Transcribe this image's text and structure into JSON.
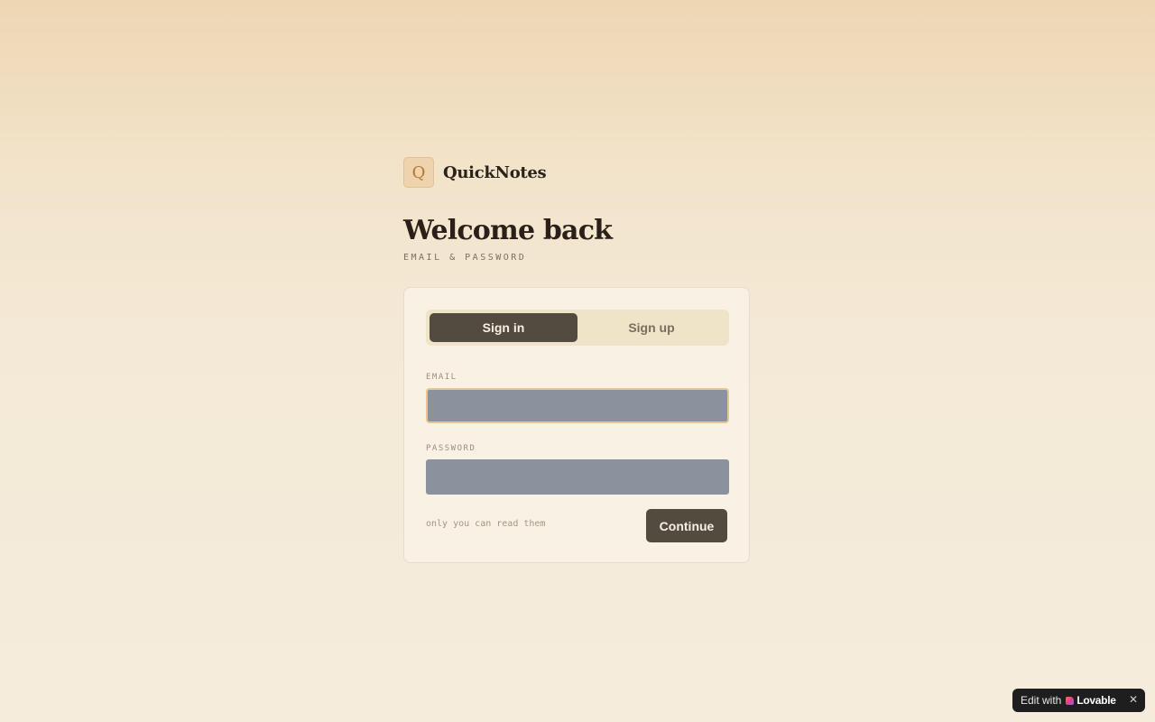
{
  "brand": {
    "logo_letter": "Q",
    "name": "QuickNotes"
  },
  "header": {
    "title": "Welcome back",
    "subtitle": "EMAIL & PASSWORD"
  },
  "auth": {
    "tabs": [
      {
        "label": "Sign in",
        "active": true
      },
      {
        "label": "Sign up",
        "active": false
      }
    ],
    "email": {
      "label": "EMAIL",
      "value": "",
      "placeholder": ""
    },
    "password": {
      "label": "PASSWORD",
      "value": "",
      "placeholder": ""
    },
    "hint": "only you can read them",
    "submit_label": "Continue"
  },
  "badge": {
    "prefix": "Edit with",
    "brand": "Lovable",
    "close_icon": "close-icon"
  },
  "colors": {
    "accent_dark": "#534a40",
    "background_top": "#eed6b3",
    "background_bottom": "#f5ecdc",
    "card": "#f9f2e4",
    "field_fill": "#8b929d",
    "focus_ring": "#e6c695"
  }
}
